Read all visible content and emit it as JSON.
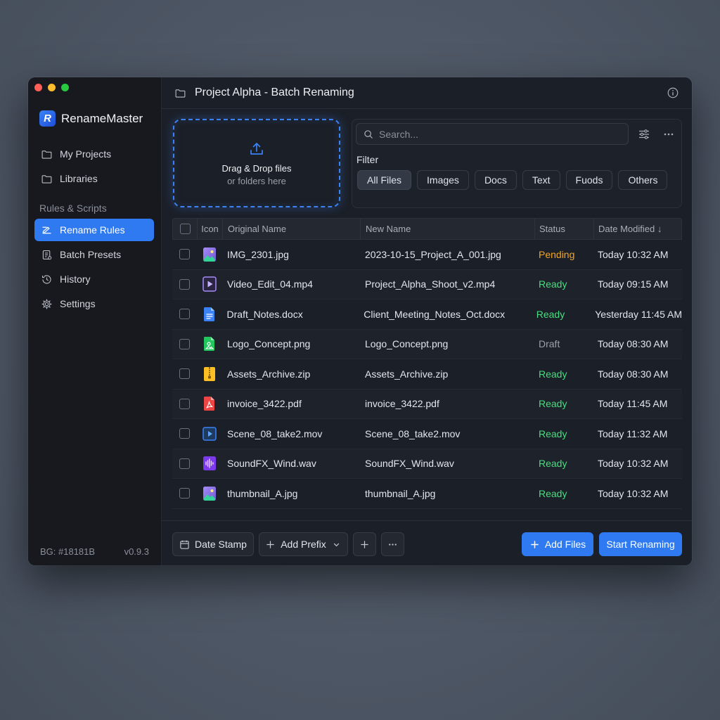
{
  "window": {
    "title": "Project Alpha - Batch Renaming"
  },
  "sidebar": {
    "app_name": "RenameMaster",
    "logo_letter": "R",
    "items": [
      {
        "label": "My Projects",
        "icon": "folder-icon"
      },
      {
        "label": "Libraries",
        "icon": "folder-icon"
      }
    ],
    "section_label": "Rules & Scripts",
    "rule_items": [
      {
        "label": "Rename Rules",
        "icon": "rename-rules-icon",
        "active": true
      },
      {
        "label": "Batch Presets",
        "icon": "preset-icon"
      },
      {
        "label": "History",
        "icon": "history-icon"
      },
      {
        "label": "Settings",
        "icon": "gear-icon"
      }
    ],
    "footer_left": "BG: #18181B",
    "footer_right": "v0.9.3"
  },
  "dropzone": {
    "title": "Drag & Drop files",
    "subtitle": "or folders here"
  },
  "filter": {
    "search_placeholder": "Search...",
    "label": "Filter",
    "chips": [
      "All Files",
      "Images",
      "Docs",
      "Text",
      "Fuods",
      "Others"
    ],
    "active_chip": "All Files"
  },
  "table": {
    "headers": {
      "icon": "Icon",
      "original": "Original Name",
      "new": "New Name",
      "status": "Status",
      "date": "Date Modified ↓"
    },
    "rows": [
      {
        "icon": "image-file-icon",
        "original": "IMG_2301.jpg",
        "new": "2023-10-15_Project_A_001.jpg",
        "status": "Pending",
        "date": "Today 10:32 AM"
      },
      {
        "icon": "video-file-icon",
        "original": "Video_Edit_04.mp4",
        "new": "Project_Alpha_Shoot_v2.mp4",
        "status": "Ready",
        "date": "Today 09:15 AM"
      },
      {
        "icon": "document-file-icon",
        "original": "Draft_Notes.docx",
        "new": "Client_Meeting_Notes_Oct.docx",
        "status": "Ready",
        "date": "Yesterday 11:45 AM"
      },
      {
        "icon": "png-file-icon",
        "original": "Logo_Concept.png",
        "new": "Logo_Concept.png",
        "status": "Draft",
        "date": "Today 08:30 AM"
      },
      {
        "icon": "zip-file-icon",
        "original": "Assets_Archive.zip",
        "new": "Assets_Archive.zip",
        "status": "Ready",
        "date": "Today 08:30 AM"
      },
      {
        "icon": "pdf-file-icon",
        "original": "invoice_3422.pdf",
        "new": "invoice_3422.pdf",
        "status": "Ready",
        "date": "Today 11:45 AM"
      },
      {
        "icon": "movie-file-icon",
        "original": "Scene_08_take2.mov",
        "new": "Scene_08_take2.mov",
        "status": "Ready",
        "date": "Today 11:32 AM"
      },
      {
        "icon": "audio-file-icon",
        "original": "SoundFX_Wind.wav",
        "new": "SoundFX_Wind.wav",
        "status": "Ready",
        "date": "Today 10:32 AM"
      },
      {
        "icon": "image-file-icon",
        "original": "thumbnail_A.jpg",
        "new": "thumbnail_A.jpg",
        "status": "Ready",
        "date": "Today 10:32 AM"
      }
    ]
  },
  "footer": {
    "date_stamp": "Date Stamp",
    "add_prefix": "Add Prefix",
    "add_files": "Add Files",
    "start_renaming": "Start Renaming"
  },
  "colors": {
    "accent": "#2f7af0",
    "ready": "#4ade80",
    "pending": "#f5a623",
    "draft": "#9aa0ab"
  }
}
